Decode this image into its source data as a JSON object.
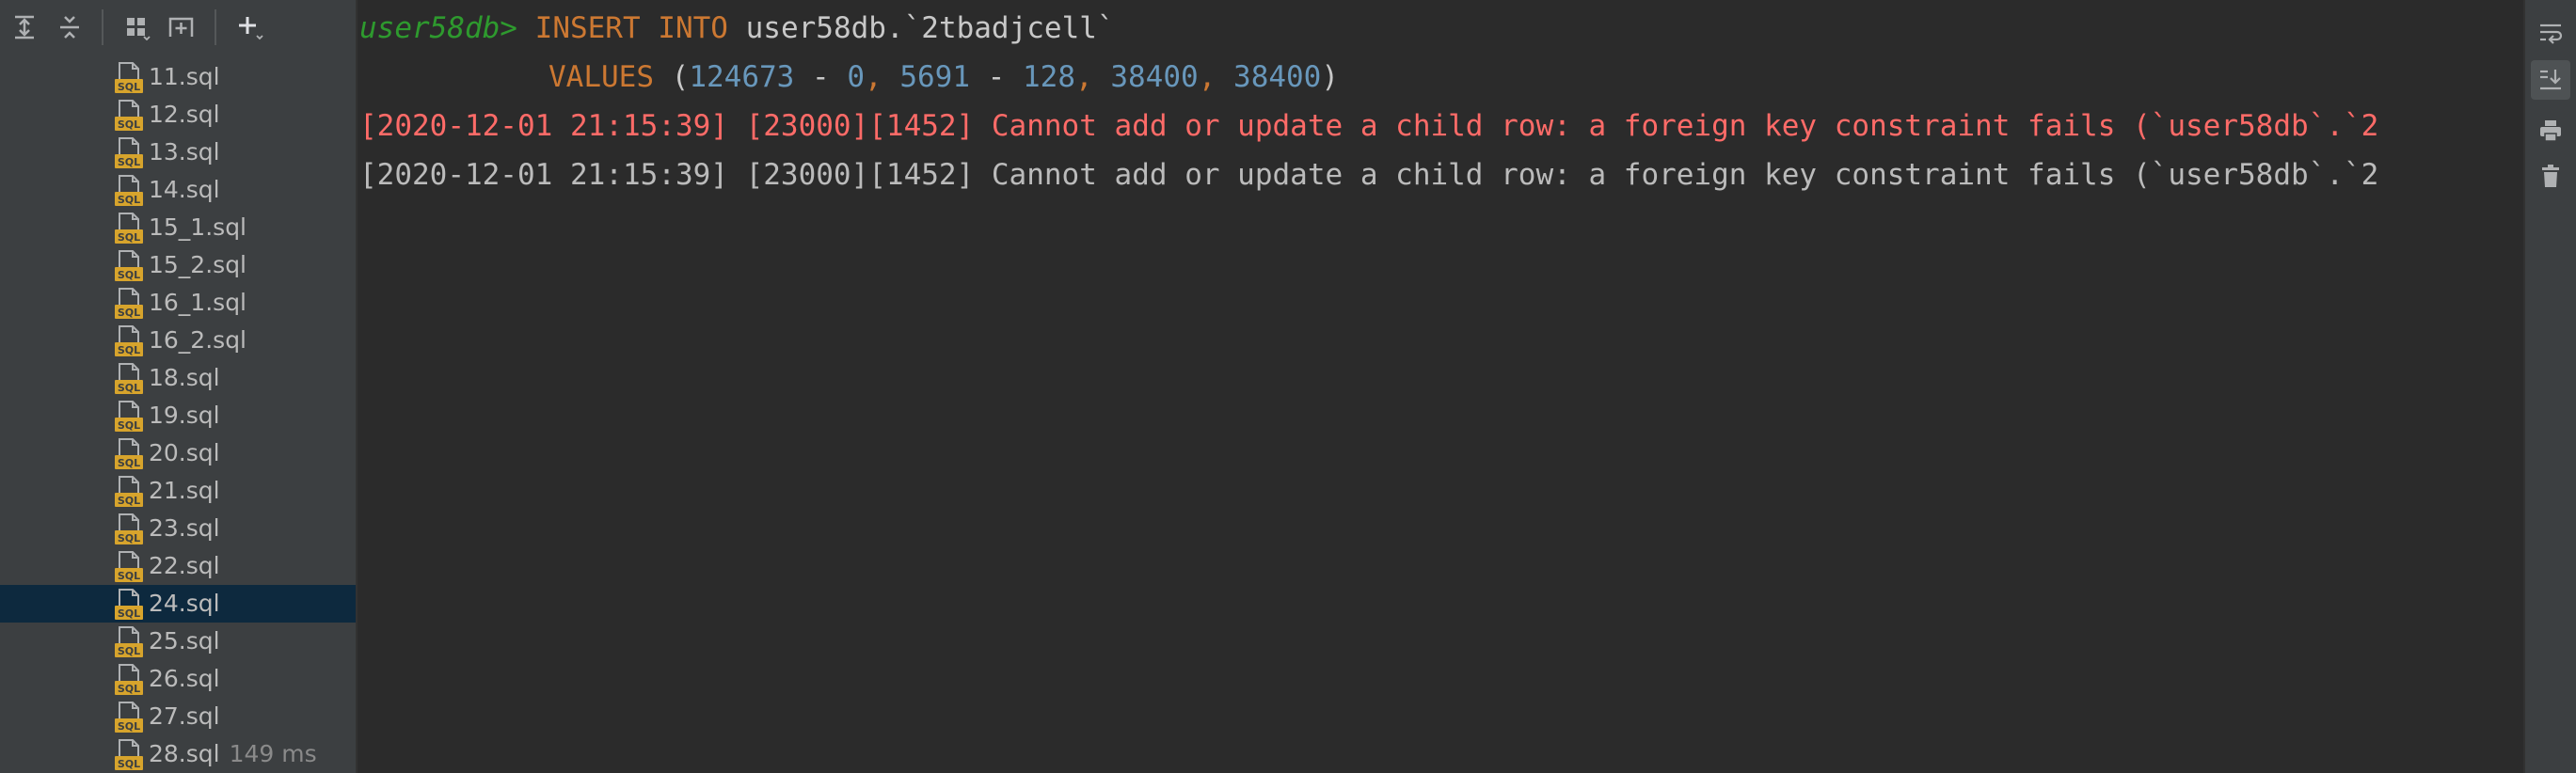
{
  "files": [
    {
      "name": "11.sql"
    },
    {
      "name": "12.sql"
    },
    {
      "name": "13.sql"
    },
    {
      "name": "14.sql"
    },
    {
      "name": "15_1.sql"
    },
    {
      "name": "15_2.sql"
    },
    {
      "name": "16_1.sql"
    },
    {
      "name": "16_2.sql"
    },
    {
      "name": "18.sql"
    },
    {
      "name": "19.sql"
    },
    {
      "name": "20.sql"
    },
    {
      "name": "21.sql"
    },
    {
      "name": "23.sql"
    },
    {
      "name": "22.sql"
    },
    {
      "name": "24.sql",
      "selected": true
    },
    {
      "name": "25.sql"
    },
    {
      "name": "26.sql"
    },
    {
      "name": "27.sql"
    },
    {
      "name": "28.sql",
      "time": "149 ms"
    }
  ],
  "console": {
    "prompt": "user58db>",
    "insert_keywords": "INSERT INTO",
    "insert_target": "user58db.`2tbadjcell`",
    "values_keyword": "VALUES",
    "paren_open": "(",
    "v1": "124673",
    "op1": "-",
    "v2": "0",
    "comma1": ",",
    "v3": "5691",
    "op2": "-",
    "v4": "128",
    "comma2": ",",
    "v5": "38400",
    "comma3": ",",
    "v6": "38400",
    "paren_close": ")",
    "error_line": "[2020-12-01 21:15:39] [23000][1452] Cannot add or update a child row: a foreign key constraint fails (`user58db`.`2",
    "info_timestamp": "[2020-12-01 21:15:39] [23000][1452] Cannot add or update a child row: a foreign key constraint fails (`user58db`.`2"
  },
  "icons": {
    "toolbar": [
      "expand-all-icon",
      "collapse-all-icon",
      "group-icon",
      "pin-tab-icon",
      "add-icon"
    ],
    "right": [
      "soft-wrap-icon",
      "scroll-to-end-icon",
      "print-icon",
      "clear-all-icon"
    ]
  },
  "colors": {
    "error": "#ff6b68",
    "keyword": "#cc7832",
    "number": "#6897bb",
    "prompt": "#2e9a2e",
    "selection": "#0d293e"
  }
}
